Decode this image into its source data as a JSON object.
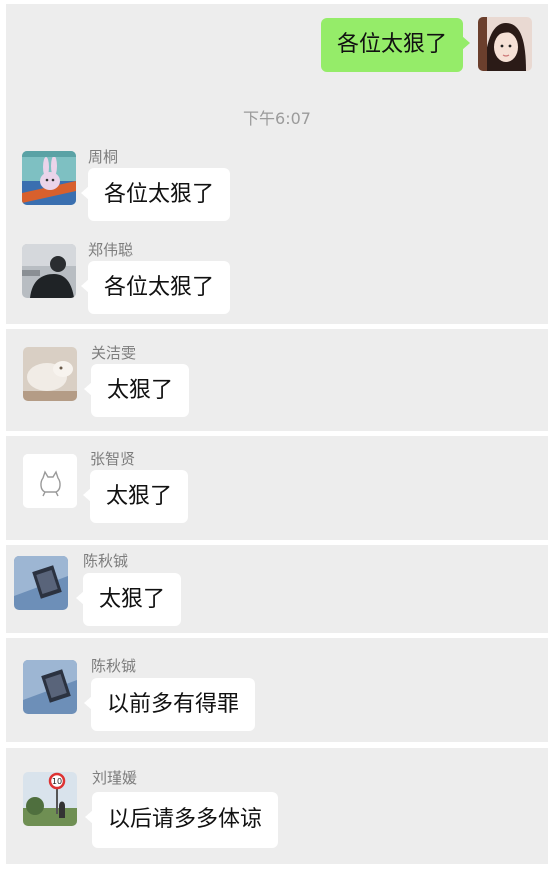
{
  "time_divider": "下午6:07",
  "outgoing": {
    "text": "各位太狠了"
  },
  "messages": [
    {
      "sender": "周桐",
      "text": "各位太狠了",
      "avatar": "bunny-cartoon-avatar"
    },
    {
      "sender": "郑伟聪",
      "text": "各位太狠了",
      "avatar": "dark-photo-avatar"
    },
    {
      "sender": "关洁雯",
      "text": "太狠了",
      "avatar": "cat-photo-avatar"
    },
    {
      "sender": "张智贤",
      "text": "太狠了",
      "avatar": "white-cat-icon-avatar"
    },
    {
      "sender": "陈秋铖",
      "text": "太狠了",
      "avatar": "blue-photo-avatar"
    },
    {
      "sender": "陈秋铖",
      "text": "以前多有得罪",
      "avatar": "blue-photo-avatar"
    },
    {
      "sender": "刘瑾媛",
      "text": "以后请多多体谅",
      "avatar": "speed-sign-avatar"
    }
  ],
  "speed_sign_text": "10",
  "colors": {
    "panel": "#ededed",
    "outgoing_bubble": "#95ec69",
    "incoming_bubble": "#ffffff"
  }
}
